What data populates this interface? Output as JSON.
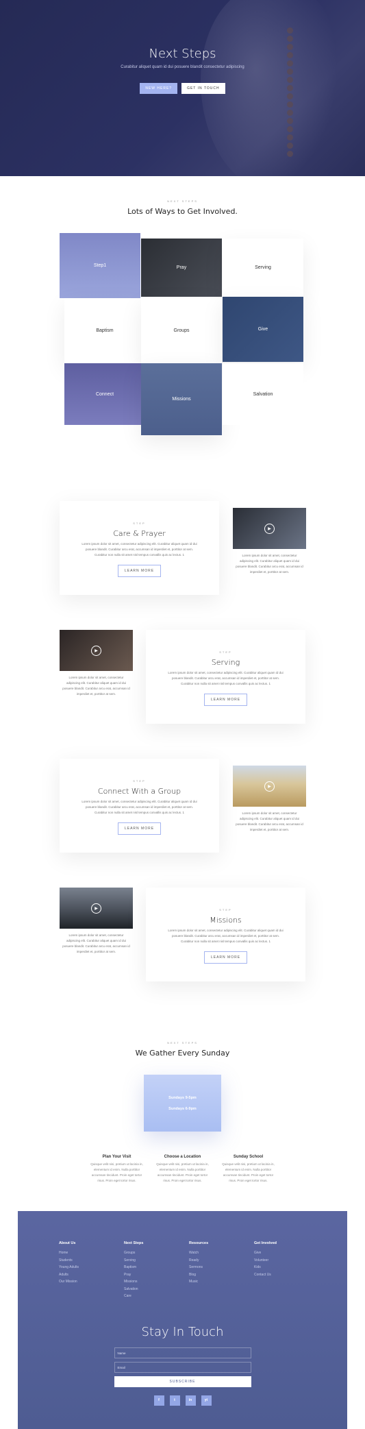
{
  "hero": {
    "title": "Next Steps",
    "subtitle": "Curabitur aliquet quam id dui posuere blandit consectetur adipiscing",
    "btn_primary": "New Here?",
    "btn_secondary": "Get in Touch"
  },
  "ways": {
    "eyebrow": "Next Steps",
    "title": "Lots of Ways to Get Involved.",
    "tiles": [
      "Step1",
      "Pray",
      "Serving",
      "Baptism",
      "Groups",
      "Give",
      "Connect",
      "Missions",
      "Salvation"
    ]
  },
  "features": [
    {
      "eyebrow": "Step",
      "title": "Care & Prayer",
      "body": "Lorem ipsum dolor sit amet, consectetur adipiscing elit. Curabitur aliquet quam id dui posuere blandit. Curabitur arcu erat, accumsan id imperdiet et, porttitor at sem. Curabitur non nulla sit amet nisl tempus convallis quis ac lectus. 1",
      "button": "Learn More",
      "side": "Lorem ipsum dolor sit amet, consectetur adipiscing elit. Curabitur aliquet quam id dui posuere blandit. Curabitur arcu erat, accumsan id imperdiet et, porttitor at sem."
    },
    {
      "eyebrow": "Step",
      "title": "Serving",
      "body": "Lorem ipsum dolor sit amet, consectetur adipiscing elit. Curabitur aliquet quam id dui posuere blandit. Curabitur arcu erat, accumsan id imperdiet et, porttitor at sem. Curabitur non nulla sit amet nisl tempus convallis quis ac lectus. 1",
      "button": "Learn More",
      "side": "Lorem ipsum dolor sit amet, consectetur adipiscing elit. Curabitur aliquet quam id dui posuere blandit. Curabitur arcu erat, accumsan id imperdiet et, porttitor at sem."
    },
    {
      "eyebrow": "Step",
      "title": "Connect With a Group",
      "body": "Lorem ipsum dolor sit amet, consectetur adipiscing elit. Curabitur aliquet quam id dui posuere blandit. Curabitur arcu erat, accumsan id imperdiet et, porttitor at sem. Curabitur non nulla sit amet nisl tempus convallis quis ac lectus. 1",
      "button": "Learn More",
      "side": "Lorem ipsum dolor sit amet, consectetur adipiscing elit. Curabitur aliquet quam id dui posuere blandit. Curabitur arcu erat, accumsan id imperdiet et, porttitor at sem."
    },
    {
      "eyebrow": "Step",
      "title": "Missions",
      "body": "Lorem ipsum dolor sit amet, consectetur adipiscing elit. Curabitur aliquet quam id dui posuere blandit. Curabitur arcu erat, accumsan id imperdiet et, porttitor at sem. Curabitur non nulla sit amet nisl tempus convallis quis ac lectus. 1",
      "button": "Learn More",
      "side": "Lorem ipsum dolor sit amet, consectetur adipiscing elit. Curabitur aliquet quam id dui posuere blandit. Curabitur arcu erat, accumsan id imperdiet et, porttitor at sem."
    }
  ],
  "sunday": {
    "eyebrow": "Next Steps",
    "title": "We Gather Every Sunday",
    "times": [
      "Sundays 9-5pm",
      "Sundays 6-9pm"
    ],
    "columns": [
      {
        "title": "Plan Your Visit",
        "body": "Quisque velit nisi, pretium ut lacinia in, elementum id enim. Nulla porttitor accumsan tincidunt. Proin eget tortor risus. Proin eget tortor risus."
      },
      {
        "title": "Choose a Location",
        "body": "Quisque velit nisi, pretium ut lacinia in, elementum id enim. Nulla porttitor accumsan tincidunt. Proin eget tortor risus. Proin eget tortor risus."
      },
      {
        "title": "Sunday School",
        "body": "Quisque velit nisi, pretium ut lacinia in, elementum id enim. Nulla porttitor accumsan tincidunt. Proin eget tortor risus. Proin eget tortor risus."
      }
    ]
  },
  "footer": {
    "columns": [
      {
        "title": "About Us",
        "links": [
          "Home",
          "Students",
          "Young Adults",
          "Adults",
          "Our Mission"
        ]
      },
      {
        "title": "Next Steps",
        "links": [
          "Groups",
          "Serving",
          "Baptism",
          "Pray",
          "Missions",
          "Salvation",
          "Care"
        ]
      },
      {
        "title": "Resources",
        "links": [
          "Watch",
          "Ready",
          "Sermons",
          "Blog",
          "Music"
        ]
      },
      {
        "title": "Get Involved",
        "links": [
          "Give",
          "Volunteer",
          "Kids",
          "Contact Us"
        ]
      }
    ],
    "heading": "Stay In Touch",
    "name_placeholder": "Name",
    "email_placeholder": "Email",
    "subscribe": "Subscribe",
    "social": [
      "f",
      "t",
      "in",
      "yt"
    ]
  }
}
